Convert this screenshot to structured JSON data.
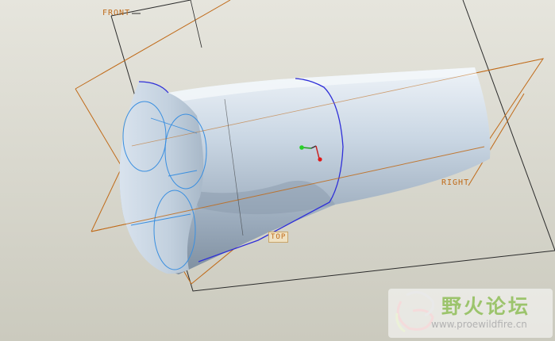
{
  "viewport": {
    "background_top": "#e6e5dd",
    "background_bottom": "#cbcabe"
  },
  "datum_planes": {
    "front": "FRONT",
    "right": "RIGHT",
    "top": "TOP",
    "color": "#c06a18"
  },
  "model": {
    "surface_color": "#b5c4d4",
    "edge_color": "#2f2fd8",
    "curve_color": "#3a8fe0"
  },
  "watermark": {
    "title": "野火论坛",
    "url": "www.proewildfire.cn"
  }
}
